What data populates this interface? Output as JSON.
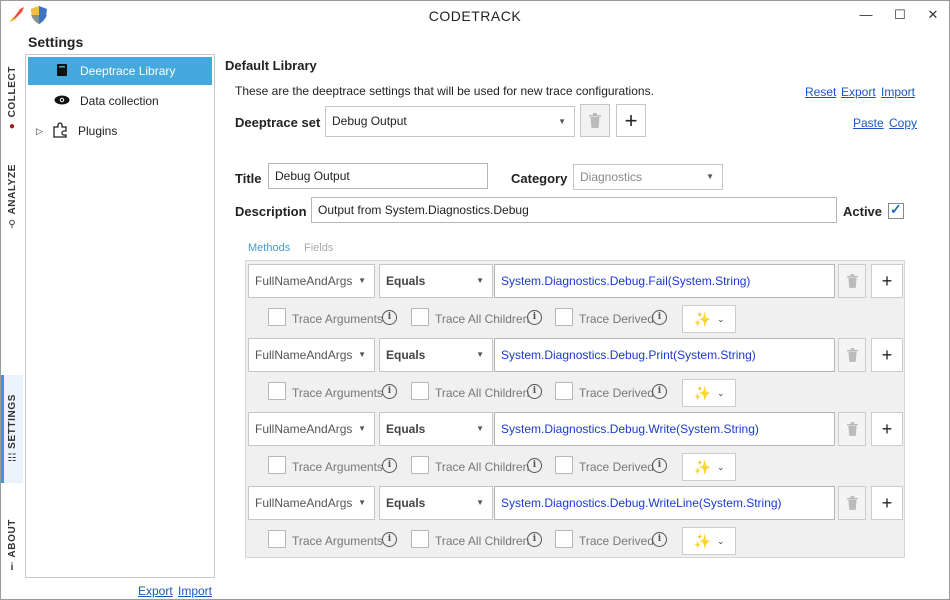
{
  "window": {
    "title": "CODETRACK"
  },
  "vtabs": [
    {
      "label": "COLLECT",
      "icon": "record-icon"
    },
    {
      "label": "ANALYZE",
      "icon": "magnifier-icon"
    },
    {
      "label": "SETTINGS",
      "icon": "sliders-icon"
    },
    {
      "label": "ABOUT",
      "icon": "info-icon"
    }
  ],
  "settings": {
    "title": "Settings",
    "tree": [
      {
        "label": "Deeptrace Library",
        "icon": "book-icon"
      },
      {
        "label": "Data collection",
        "icon": "eye-icon"
      },
      {
        "label": "Plugins",
        "icon": "puzzle-icon"
      }
    ],
    "export_label": "Export",
    "import_label": "Import"
  },
  "library": {
    "heading": "Default Library",
    "description": "These are the deeptrace settings that will be used for new trace configurations.",
    "reset_label": "Reset",
    "export_label": "Export",
    "import_label": "Import",
    "paste_label": "Paste",
    "copy_label": "Copy",
    "deeptrace_set_label": "Deeptrace set",
    "deeptrace_set_value": "Debug Output",
    "title_label": "Title",
    "title_value": "Debug Output",
    "category_label": "Category",
    "category_value": "Diagnostics",
    "description_label": "Description",
    "description_value": "Output from System.Diagnostics.Debug",
    "active_label": "Active",
    "active": true
  },
  "tabs": {
    "methods": "Methods",
    "fields": "Fields"
  },
  "options": {
    "trace_arguments": "Trace Arguments",
    "trace_all_children": "Trace All Children",
    "trace_derived": "Trace Derived"
  },
  "rules": [
    {
      "match": "FullNameAndArgs",
      "operator": "Equals",
      "value": "System.Diagnostics.Debug.Fail(System.String)"
    },
    {
      "match": "FullNameAndArgs",
      "operator": "Equals",
      "value": "System.Diagnostics.Debug.Print(System.String)"
    },
    {
      "match": "FullNameAndArgs",
      "operator": "Equals",
      "value": "System.Diagnostics.Debug.Write(System.String)"
    },
    {
      "match": "FullNameAndArgs",
      "operator": "Equals",
      "value": "System.Diagnostics.Debug.WriteLine(System.String)"
    }
  ],
  "colors": {
    "accent": "#45a9dd",
    "link": "#1a56c2",
    "value_text": "#1a3ad0"
  }
}
